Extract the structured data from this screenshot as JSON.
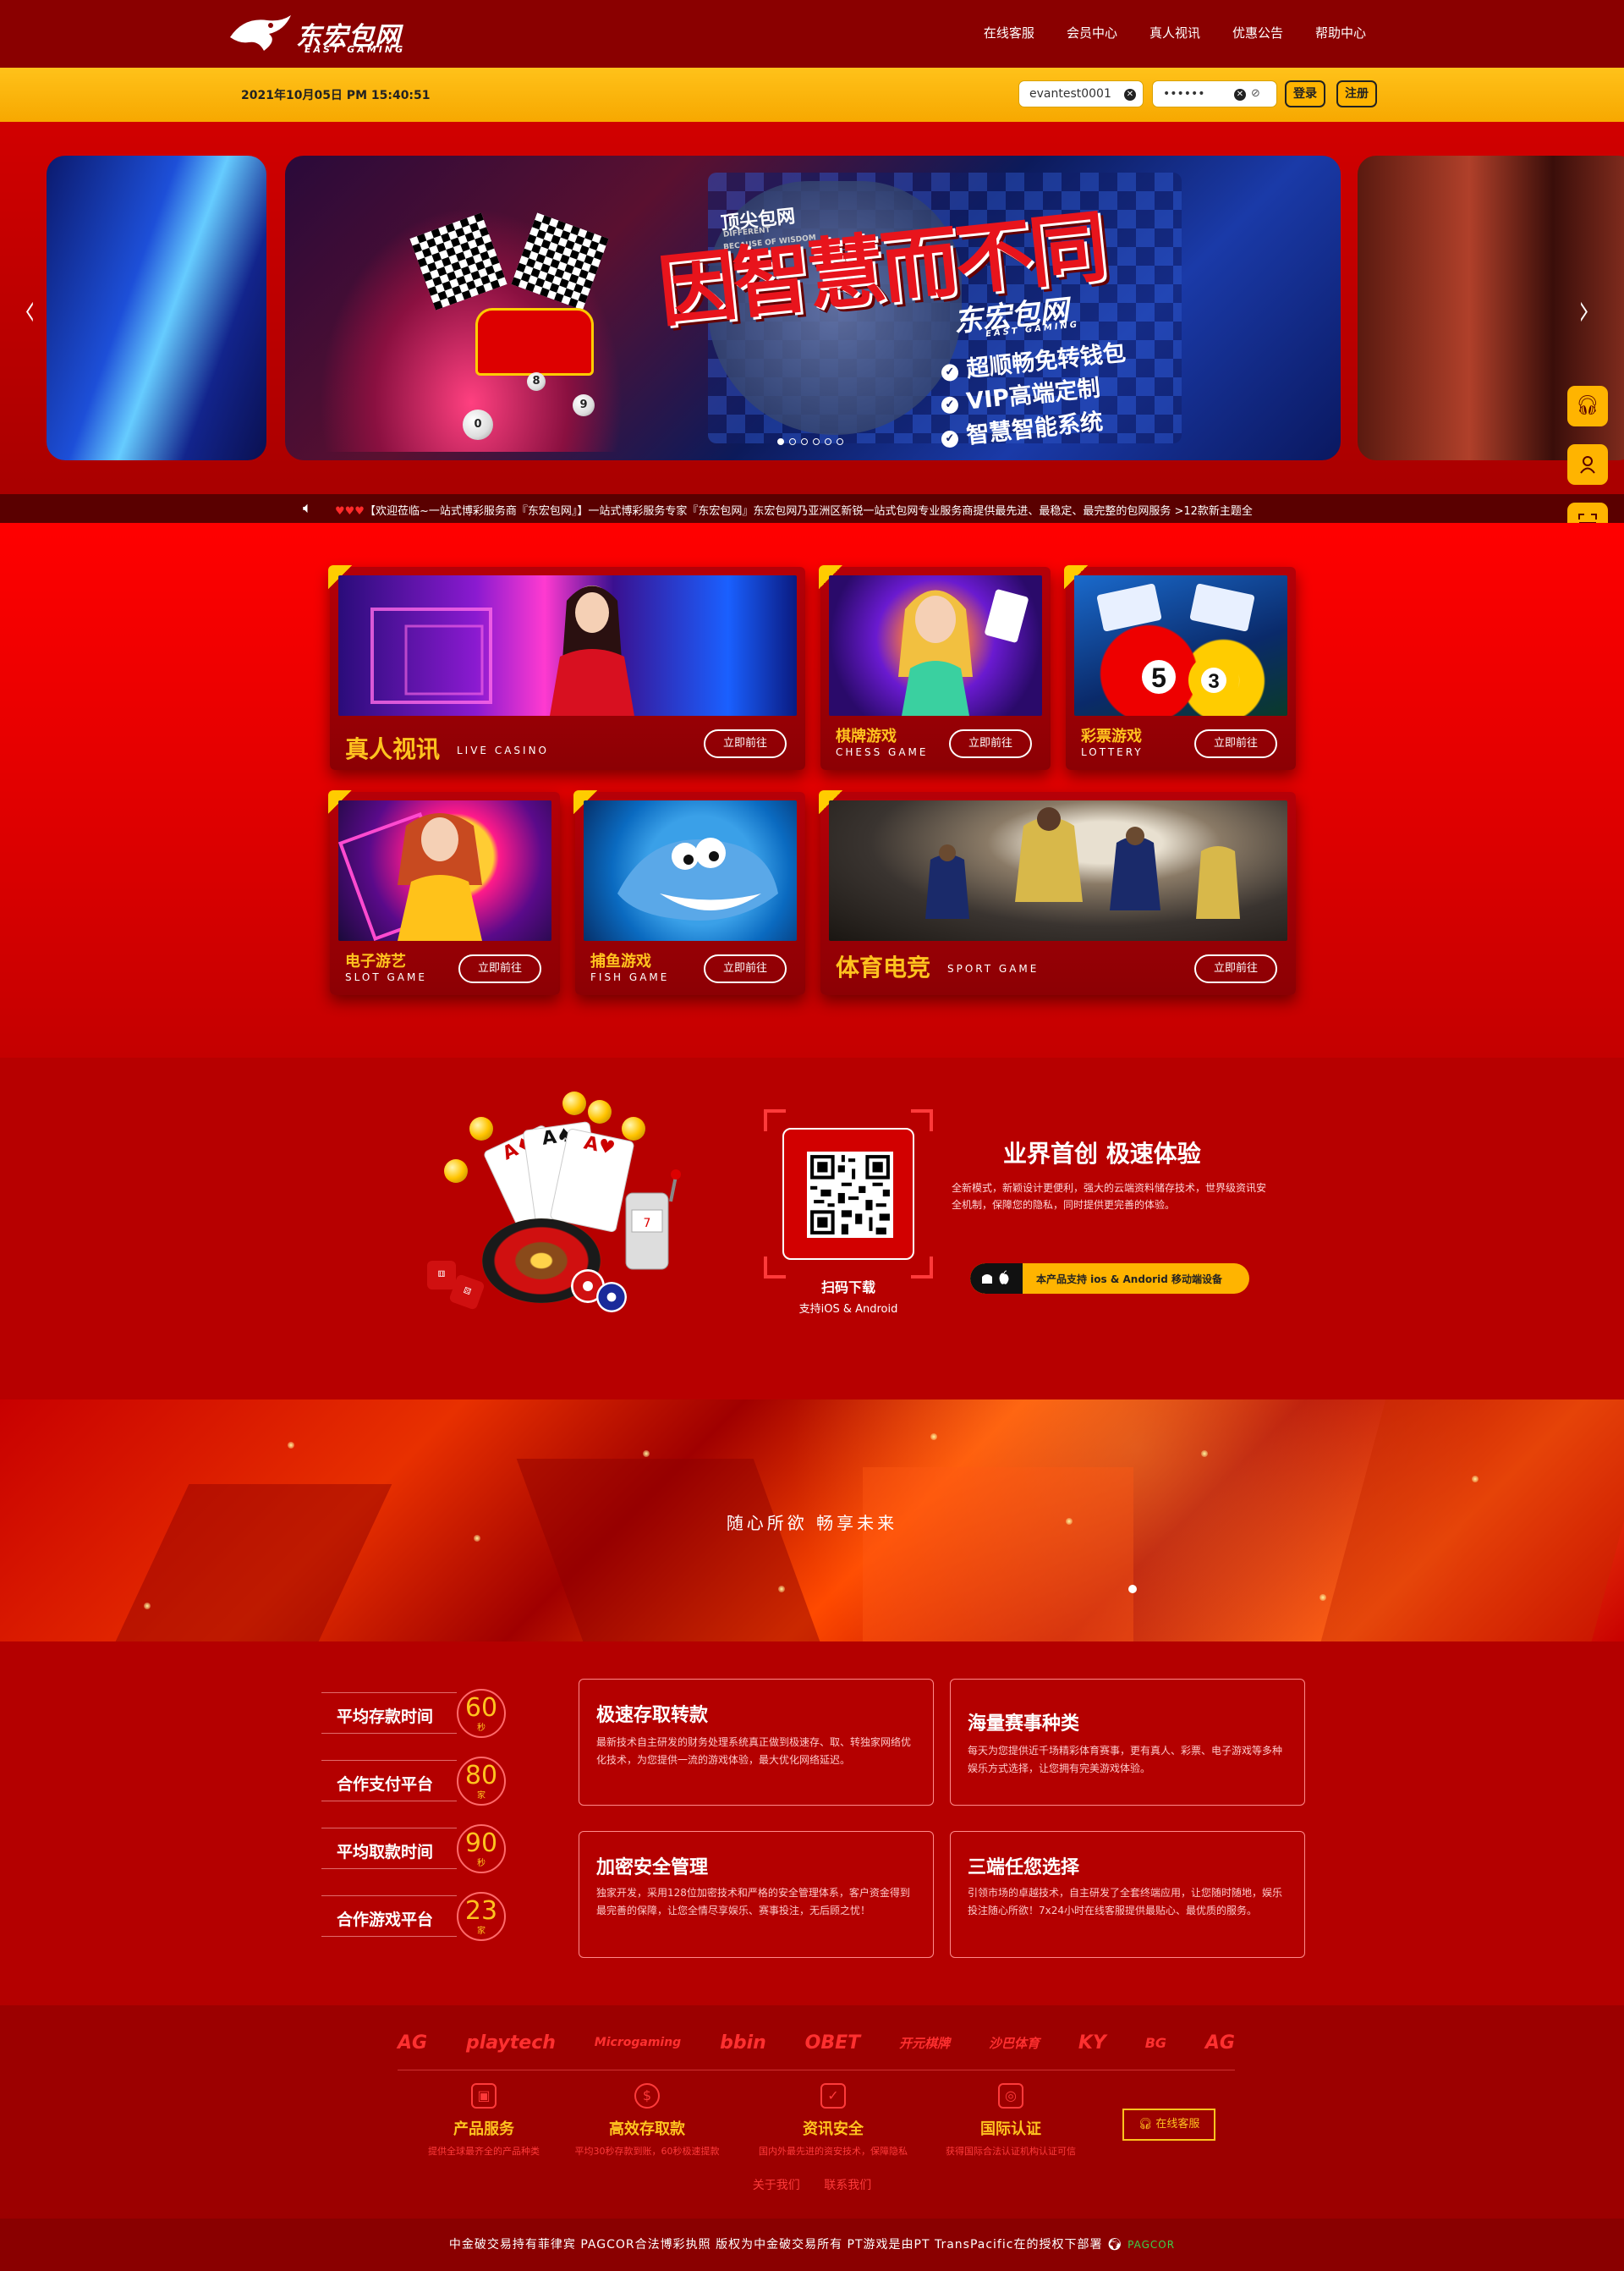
{
  "header": {
    "logo_text": "东宏包网",
    "logo_sub": "EAST GAMING",
    "nav": [
      "在线客服",
      "会员中心",
      "真人视讯",
      "优惠公告",
      "帮助中心"
    ]
  },
  "topbar": {
    "datetime": "2021年10月05日 PM 15:40:51",
    "username_value": "evantest0001",
    "password_value": "••••••",
    "login_label": "登录",
    "register_label": "注册"
  },
  "banner": {
    "small_title": "顶尖包网",
    "small_en_1": "DIFFERENT",
    "small_en_2": "BECAUSE OF WISDOM",
    "title": "因智慧而不同",
    "logo": "东宏包网",
    "logo_sub": "EAST GAMING",
    "features": [
      "超顺畅免转钱包",
      "VIP高端定制",
      "智慧智能系统"
    ],
    "prev_arrow": "‹",
    "next_arrow": "›",
    "slide_count": 6,
    "active_slide": 0
  },
  "notice": {
    "hearts": "♥♥♥",
    "text": "【欢迎莅临~一站式博彩服务商『东宏包网』】一站式博彩服务专家『东宏包网』东宏包网乃亚洲区新锐一站式包网专业服务商提供最先进、最稳定、最完整的包网服务 >12款新主题全"
  },
  "floats": [
    "headset-icon",
    "user-icon",
    "scan-icon"
  ],
  "games": [
    {
      "cn": "真人视讯",
      "en": "LIVE CASINO",
      "go": "立即前往"
    },
    {
      "cn": "棋牌游戏",
      "en": "CHESS GAME",
      "go": "立即前往"
    },
    {
      "cn": "彩票游戏",
      "en": "LOTTERY",
      "go": "立即前往"
    },
    {
      "cn": "电子游艺",
      "en": "SLOT GAME",
      "go": "立即前往"
    },
    {
      "cn": "捕鱼游戏",
      "en": "FISH GAME",
      "go": "立即前往"
    },
    {
      "cn": "体育电竞",
      "en": "SPORT GAME",
      "go": "立即前往"
    }
  ],
  "app": {
    "qr_title": "扫码下载",
    "qr_sub": "支持iOS & Android",
    "heading": "业界首创 极速体验",
    "desc": "全新模式，新颖设计更便利，强大的云端资料储存技术，世界级资讯安全机制，保障您的隐私，同时提供更完善的体验。",
    "pill_os": "  ",
    "pill_text": "本产品支持 ios & Andorid 移动端设备"
  },
  "banner2": {
    "text": "随心所欲 畅享未来"
  },
  "stats": [
    {
      "label": "平均存款时间",
      "value": "60",
      "unit": "秒"
    },
    {
      "label": "合作支付平台",
      "value": "80",
      "unit": "家"
    },
    {
      "label": "平均取款时间",
      "value": "90",
      "unit": "秒"
    },
    {
      "label": "合作游戏平台",
      "value": "23",
      "unit": "家"
    }
  ],
  "features": [
    {
      "title": "极速存取转款",
      "desc": "最新技术自主研发的财务处理系统真正做到极速存、取、转独家网络优化技术，为您提供一流的游戏体验，最大优化网络延迟。"
    },
    {
      "title": "海量赛事种类",
      "desc": "每天为您提供近千场精彩体育赛事，更有真人、彩票、电子游戏等多种娱乐方式选择，让您拥有完美游戏体验。"
    },
    {
      "title": "加密安全管理",
      "desc": "独家开发，采用128位加密技术和严格的安全管理体系，客户资金得到最完善的保障，让您全情尽享娱乐、赛事投注，无后顾之忧！"
    },
    {
      "title": "三端任您选择",
      "desc": "引领市场的卓越技术，自主研发了全套终端应用，让您随时随地，娱乐投注随心所欲！7x24小时在线客服提供最贴心、最优质的服务。"
    }
  ],
  "footer": {
    "partners": [
      "AG",
      "playtech",
      "Microgaming",
      "bbin",
      "OBET",
      "开元棋牌",
      "沙巴体育",
      "KY",
      "BG",
      "AG"
    ],
    "items": [
      {
        "icon": "gift-icon",
        "title": "产品服务",
        "desc": "提供全球最齐全的产品种类"
      },
      {
        "icon": "dollar-icon",
        "title": "高效存取款",
        "desc": "平均30秒存款到账，60秒极速提款"
      },
      {
        "icon": "shield-icon",
        "title": "资讯安全",
        "desc": "国内外最先进的资安技术，保障隐私"
      },
      {
        "icon": "certificate-icon",
        "title": "国际认证",
        "desc": "获得国际合法认证机构认证可信"
      }
    ],
    "service_label": "在线客服",
    "links": [
      "关于我们",
      "联系我们"
    ],
    "copyright": "中金破交易持有菲律宾 PAGCOR合法博彩执照 版权为中金破交易所有 PT游戏是由PT TransPacific在的授权下部署",
    "pagcor": "PAGCOR"
  },
  "colors": {
    "primary_red": "#b40000",
    "accent_yellow": "#ffc31f",
    "topbar_yellow": "#ffb400"
  }
}
